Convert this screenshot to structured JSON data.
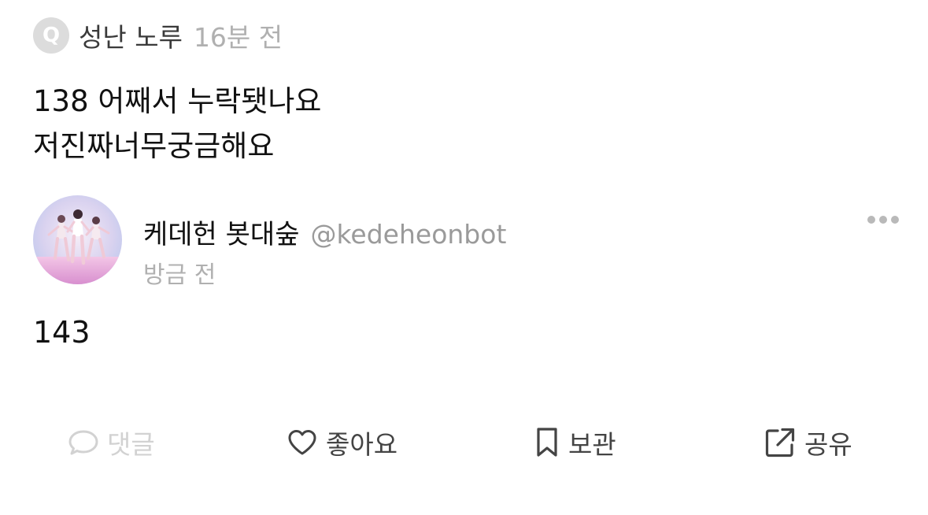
{
  "question": {
    "badge": "Q",
    "asker_name": "성난 노루",
    "time": "16분 전",
    "lines": [
      "138 어째서 누락됏나요",
      "저진짜너무궁금해요"
    ]
  },
  "answer": {
    "author_name": "케데헌 봇대숲",
    "author_handle": "@kedeheonbot",
    "time": "방금 전",
    "text": "143"
  },
  "actions": {
    "comment": "댓글",
    "like": "좋아요",
    "save": "보관",
    "share": "공유"
  },
  "icons": {
    "q": "q-badge-icon",
    "more": "more-dots-icon",
    "comment": "comment-bubble-icon",
    "like": "heart-icon",
    "save": "bookmark-icon",
    "share": "share-external-icon"
  },
  "colors": {
    "text_primary": "#111111",
    "text_secondary": "#9a9a9a",
    "muted": "#b0b0b0",
    "disabled": "#d2d2d2",
    "badge_bg": "#dcdcdc"
  }
}
